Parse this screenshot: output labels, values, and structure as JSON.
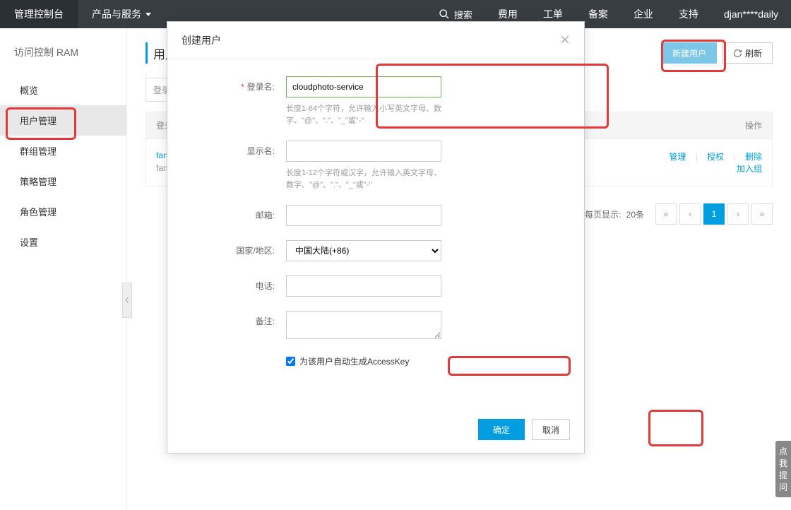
{
  "topbar": {
    "brand": "管理控制台",
    "products": "产品与服务",
    "search": "搜索",
    "links": [
      "费用",
      "工单",
      "备案",
      "企业",
      "支持"
    ],
    "user": "djan****daily"
  },
  "sidebar": {
    "title": "访问控制 RAM",
    "items": [
      "概览",
      "用户管理",
      "群组管理",
      "策略管理",
      "角色管理",
      "设置"
    ]
  },
  "page": {
    "title": "用户",
    "new_user": "新建用户",
    "refresh": "刷新",
    "search_placeholder": "登录名",
    "table_header_login": "登录名",
    "table_header_ops": "操作",
    "row1_login": "fanno",
    "row1_sub": "fanno",
    "ops": {
      "manage": "管理",
      "auth": "授权",
      "delete": "删除",
      "addgroup": "加入组"
    }
  },
  "pagination": {
    "label": "每页显示:",
    "size": "20条",
    "prev2": "«",
    "prev": "‹",
    "page1": "1",
    "next": "›",
    "next2": "»"
  },
  "feedback": "点我提问",
  "modal": {
    "title": "创建用户",
    "fields": {
      "login_label": "登录名:",
      "login_value": "cloudphoto-service",
      "login_hint": "长度1-64个字符，允许输入小写英文字母、数字、\"@\"、\".\"、\"_\"或\"-\"",
      "display_label": "显示名:",
      "display_hint": "长度1-12个字符或汉字，允许输入英文字母、数字、\"@\"、\".\"、\"_\"或\"-\"",
      "email_label": "邮箱:",
      "region_label": "国家/地区:",
      "region_value": "中国大陆(+86)",
      "phone_label": "电话:",
      "remark_label": "备注:",
      "ak_label": "为该用户自动生成AccessKey"
    },
    "ok": "确定",
    "cancel": "取消"
  }
}
